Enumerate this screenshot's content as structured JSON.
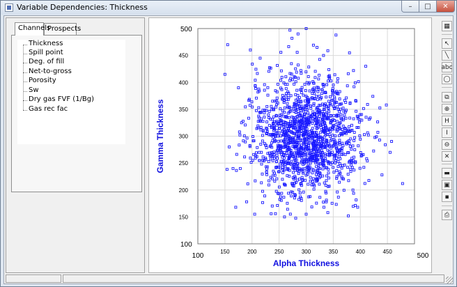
{
  "window": {
    "title": "Variable Dependencies: Thickness",
    "controls": {
      "minimize": "–",
      "maximize": "□",
      "close": "✕"
    }
  },
  "left_panel": {
    "tabs": [
      {
        "label": "Channels",
        "active": true
      },
      {
        "label": "Prospects",
        "active": false
      }
    ],
    "variables": [
      "Thickness",
      "Spill point",
      "Deg. of fill",
      "Net-to-gross",
      "Porosity",
      "Sw",
      "Dry gas FVF (1/Bg)",
      "Gas rec fac"
    ]
  },
  "toolbar": {
    "buttons": [
      {
        "name": "chart-properties-icon",
        "glyph": "▦"
      },
      {
        "name": "pointer-icon",
        "glyph": "↖"
      },
      {
        "name": "draw-line-icon",
        "glyph": "╲"
      },
      {
        "name": "text-label-icon",
        "glyph": "abc"
      },
      {
        "name": "shape-icon",
        "glyph": "◯"
      },
      {
        "name": "copy-icon",
        "glyph": "⧉"
      },
      {
        "name": "zoom-in-icon",
        "glyph": "⊕"
      },
      {
        "name": "zoom-horizontal-icon",
        "glyph": "H"
      },
      {
        "name": "zoom-vertical-icon",
        "glyph": "I"
      },
      {
        "name": "zoom-out-icon",
        "glyph": "⊖"
      },
      {
        "name": "zoom-reset-icon",
        "glyph": "✕"
      },
      {
        "name": "ruler-icon",
        "glyph": "▬"
      },
      {
        "name": "export-icon",
        "glyph": "▣"
      },
      {
        "name": "save-icon",
        "glyph": "▪"
      },
      {
        "name": "print-icon",
        "glyph": "⎙"
      }
    ]
  },
  "colors": {
    "series": "#1a1aff",
    "axis_title": "#1010e0",
    "grid": "#d9d9d9"
  },
  "chart_data": {
    "type": "scatter",
    "xlabel": "Alpha Thickness",
    "ylabel": "Gamma Thickness",
    "xlim": [
      100,
      500
    ],
    "ylim": [
      100,
      500
    ],
    "x_ticks": [
      100,
      150,
      200,
      250,
      300,
      350,
      400,
      450,
      500
    ],
    "y_ticks": [
      100,
      150,
      200,
      250,
      300,
      350,
      400,
      450,
      500
    ],
    "x_tick_labels_shown": [
      "100",
      "150",
      "200",
      "250",
      "300",
      "350",
      "400",
      "450",
      "500"
    ],
    "y_tick_labels_shown": [
      "100",
      "150",
      "200",
      "250",
      "300",
      "350",
      "400",
      "450",
      "500"
    ],
    "grid": true,
    "marker": "open-square",
    "series": [
      {
        "name": "",
        "distribution": {
          "n": 1500,
          "x_mean": 300,
          "x_sd": 50,
          "y_mean": 300,
          "y_sd": 55,
          "seed": 7
        },
        "points": [
          [
            155,
            470
          ],
          [
            150,
            415
          ],
          [
            270,
            497
          ],
          [
            300,
            500
          ],
          [
            285,
            490
          ],
          [
            355,
            488
          ],
          [
            448,
            358
          ],
          [
            478,
            212
          ],
          [
            190,
            178
          ],
          [
            170,
            168
          ],
          [
            205,
            155
          ],
          [
            260,
            150
          ],
          [
            300,
            155
          ],
          [
            340,
            158
          ],
          [
            395,
            168
          ],
          [
            440,
            228
          ],
          [
            455,
            270
          ],
          [
            165,
            240
          ],
          [
            158,
            280
          ],
          [
            175,
            390
          ],
          [
            410,
            430
          ],
          [
            215,
            445
          ],
          [
            380,
            455
          ],
          [
            320,
            465
          ]
        ]
      }
    ]
  }
}
